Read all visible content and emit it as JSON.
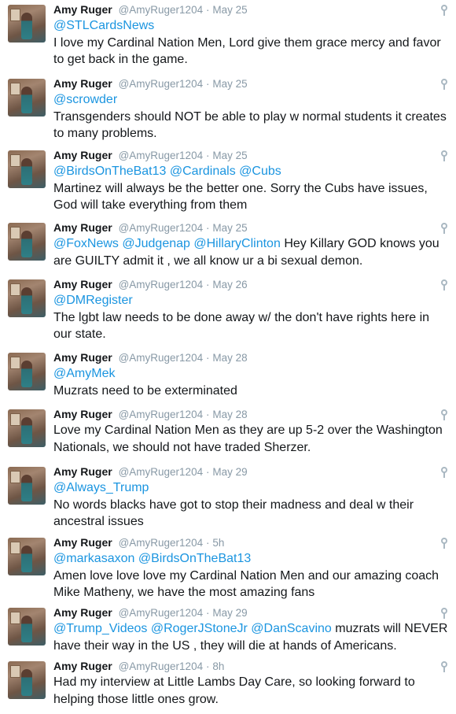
{
  "tweets": [
    {
      "name": "Amy Ruger",
      "handle": "@AmyRuger1204",
      "dot": "·",
      "time": "May 25",
      "mentions": [
        "@STLCardsNews"
      ],
      "text": "I love my Cardinal Nation Men, Lord give them grace mercy and favor to get back in the game."
    },
    {
      "name": "Amy Ruger",
      "handle": "@AmyRuger1204",
      "dot": "·",
      "time": "May 25",
      "mentions": [
        "@scrowder"
      ],
      "text": "Transgenders should NOT be able to play w normal students it creates to many problems."
    },
    {
      "name": "Amy Ruger",
      "handle": "@AmyRuger1204",
      "dot": "·",
      "time": "May 25",
      "mentions": [
        "@BirdsOnTheBat13",
        "@Cardinals",
        "@Cubs"
      ],
      "text": "Martinez will always be the better one. Sorry the Cubs have issues, God will take everything from them"
    },
    {
      "name": "Amy Ruger",
      "handle": "@AmyRuger1204",
      "dot": "·",
      "time": "May 25",
      "mentions": [
        "@FoxNews",
        "@Judgenap",
        "@HillaryClinton"
      ],
      "text": "Hey Killary GOD knows you are GUILTY admit it , we all know ur a bi sexual demon."
    },
    {
      "name": "Amy Ruger",
      "handle": "@AmyRuger1204",
      "dot": "·",
      "time": "May 26",
      "mentions": [
        "@DMRegister"
      ],
      "text": "The lgbt law needs to be done away w/ the don't have rights here in our state."
    },
    {
      "name": "Amy Ruger",
      "handle": "@AmyRuger1204",
      "dot": "·",
      "time": "May 28",
      "mentions": [
        "@AmyMek"
      ],
      "text": "Muzrats need to be exterminated"
    },
    {
      "name": "Amy Ruger",
      "handle": "@AmyRuger1204",
      "dot": "·",
      "time": "May 28",
      "mentions": [],
      "text": "Love my Cardinal Nation Men as they are up 5-2 over the Washington Nationals, we should not have traded Sherzer."
    },
    {
      "name": "Amy Ruger",
      "handle": "@AmyRuger1204",
      "dot": "·",
      "time": "May 29",
      "mentions": [
        "@Always_Trump"
      ],
      "text": "No words blacks have got to stop their madness and deal w their ancestral issues"
    },
    {
      "name": "Amy Ruger",
      "handle": "@AmyRuger1204",
      "dot": "·",
      "time": "5h",
      "mentions": [
        "@markasaxon",
        "@BirdsOnTheBat13"
      ],
      "text": "Amen love love love my Cardinal Nation Men and our amazing coach Mike Matheny, we have the most amazing fans"
    },
    {
      "name": "Amy Ruger",
      "handle": "@AmyRuger1204",
      "dot": "·",
      "time": "May 29",
      "mentions": [
        "@Trump_Videos",
        "@RogerJStoneJr",
        "@DanScavino"
      ],
      "text": "muzrats will NEVER have their way in the US , they will die at hands of Americans."
    },
    {
      "name": "Amy Ruger",
      "handle": "@AmyRuger1204",
      "dot": "·",
      "time": "8h",
      "mentions": [],
      "text": "Had my interview at Little Lambs Day Care, so looking forward to helping those little ones grow."
    }
  ],
  "colors": {
    "mention": "#1b95e0",
    "meta": "#8899a6",
    "text": "#14171a"
  },
  "icons": {
    "location": "location-pin-icon",
    "avatar": "profile-photo"
  }
}
